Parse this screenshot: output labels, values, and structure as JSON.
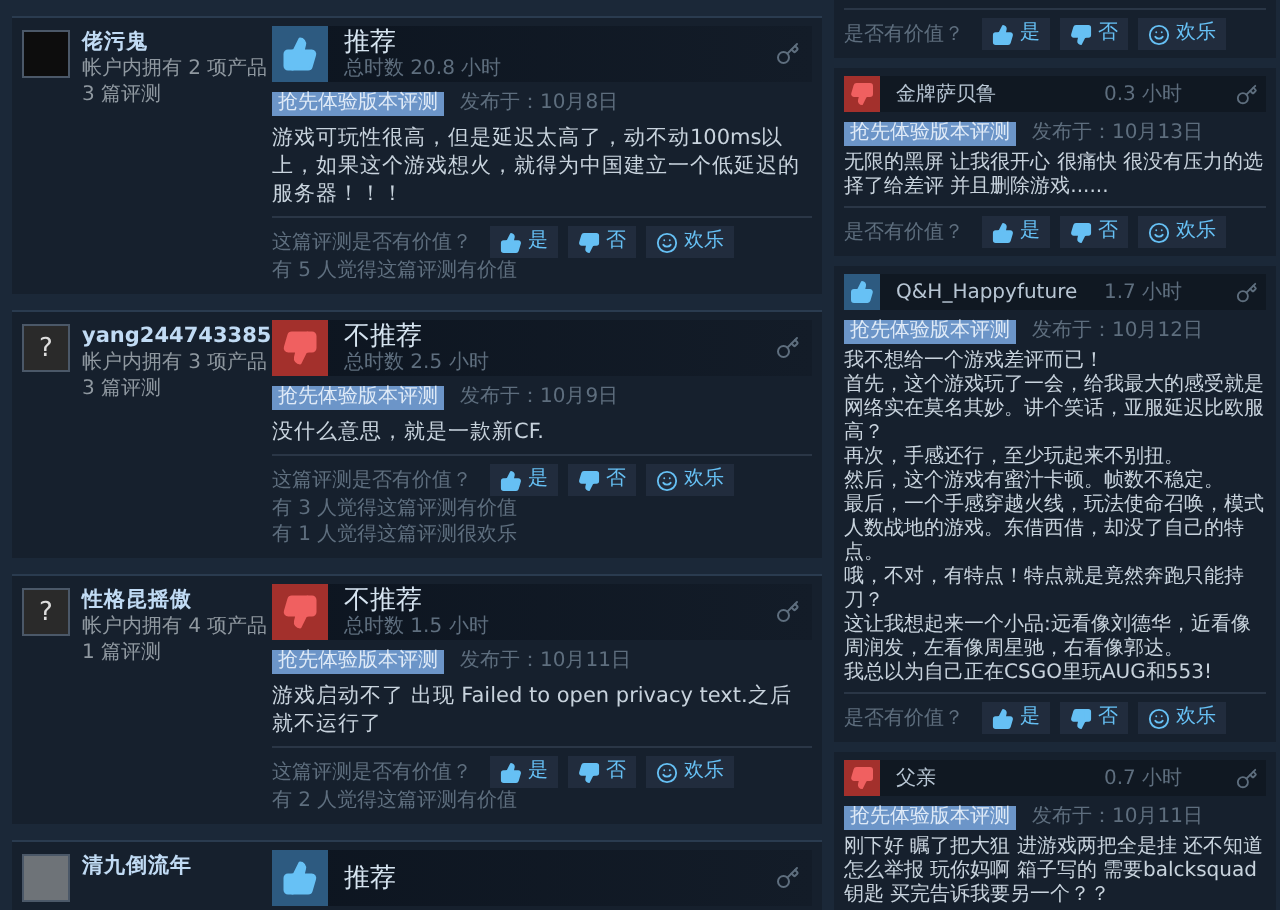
{
  "reviews": [
    {
      "author": {
        "name": "佬污鬼",
        "products": "帐户内拥有 2 项产品",
        "review_count": "3 篇评测",
        "avatar": {
          "kind": "image"
        }
      },
      "verdict": {
        "kind": "up",
        "label": "推荐"
      },
      "hours": "总时数 20.8 小时",
      "tag": "抢先体验版本评测",
      "posted": "发布于：10月8日",
      "body": "游戏可玩性很高，但是延迟太高了，动不动100ms以上，如果这个游戏想火，就得为中国建立一个低延迟的服务器！！！",
      "prompt": "这篇评测是否有价值？",
      "buttons": [
        {
          "kind": "up",
          "label": "是"
        },
        {
          "kind": "down",
          "label": "否"
        },
        {
          "kind": "funny",
          "label": "欢乐"
        }
      ],
      "counts": [
        "有 5 人觉得这篇评测有价值"
      ]
    },
    {
      "author": {
        "name": "yang244743385",
        "products": "帐户内拥有 3 项产品",
        "review_count": "3 篇评测",
        "avatar": {
          "kind": "unknown",
          "glyph": "?"
        }
      },
      "verdict": {
        "kind": "down",
        "label": "不推荐"
      },
      "hours": "总时数 2.5 小时",
      "tag": "抢先体验版本评测",
      "posted": "发布于：10月9日",
      "body": "没什么意思，就是一款新CF.",
      "prompt": "这篇评测是否有价值？",
      "buttons": [
        {
          "kind": "up",
          "label": "是"
        },
        {
          "kind": "down",
          "label": "否"
        },
        {
          "kind": "funny",
          "label": "欢乐"
        }
      ],
      "counts": [
        "有 3 人觉得这篇评测有价值",
        "有 1 人觉得这篇评测很欢乐"
      ]
    },
    {
      "author": {
        "name": "性格昆摇傲",
        "products": "帐户内拥有 4 项产品",
        "review_count": "1 篇评测",
        "avatar": {
          "kind": "unknown",
          "glyph": "?"
        }
      },
      "verdict": {
        "kind": "down",
        "label": "不推荐"
      },
      "hours": "总时数 1.5 小时",
      "tag": "抢先体验版本评测",
      "posted": "发布于：10月11日",
      "body": "游戏启动不了 出现 Failed to open privacy text.之后就不运行了",
      "prompt": "这篇评测是否有价值？",
      "buttons": [
        {
          "kind": "up",
          "label": "是"
        },
        {
          "kind": "down",
          "label": "否"
        },
        {
          "kind": "funny",
          "label": "欢乐"
        }
      ],
      "counts": [
        "有 2 人觉得这篇评测有价值"
      ]
    },
    {
      "author": {
        "name": "清九倒流年",
        "avatar": {
          "kind": "image"
        }
      },
      "verdict": {
        "kind": "up",
        "label": "推荐"
      }
    }
  ],
  "side_reviews": [
    {
      "prompt": "是否有价值？",
      "buttons": [
        {
          "kind": "up",
          "label": "是"
        },
        {
          "kind": "down",
          "label": "否"
        },
        {
          "kind": "funny",
          "label": "欢乐"
        }
      ]
    },
    {
      "verdict": {
        "kind": "down"
      },
      "name": "金牌萨贝鲁",
      "hours": "0.3 小时",
      "tag": "抢先体验版本评测",
      "posted": "发布于：10月13日",
      "body": "无限的黑屏 让我很开心 很痛快 很没有压力的选择了给差评 并且删除游戏......",
      "prompt": "是否有价值？",
      "buttons": [
        {
          "kind": "up",
          "label": "是"
        },
        {
          "kind": "down",
          "label": "否"
        },
        {
          "kind": "funny",
          "label": "欢乐"
        }
      ]
    },
    {
      "verdict": {
        "kind": "up"
      },
      "name": "Q&H_Happyfuture",
      "hours": "1.7 小时",
      "tag": "抢先体验版本评测",
      "posted": "发布于：10月12日",
      "paragraphs": [
        "我不想给一个游戏差评而已！",
        "首先，这个游戏玩了一会，给我最大的感受就是网络实在莫名其妙。讲个笑话，亚服延迟比欧服高？",
        "再次，手感还行，至少玩起来不别扭。",
        "然后，这个游戏有蜜汁卡顿。帧数不稳定。",
        "最后，一个手感穿越火线，玩法使命召唤，模式人数战地的游戏。东借西借，却没了自己的特点。",
        "哦，不对，有特点！特点就是竟然奔跑只能持刀？",
        "这让我想起来一个小品:远看像刘德华，近看像周润发，左看像周星驰，右看像郭达。",
        "我总以为自己正在CSGO里玩AUG和553!"
      ],
      "prompt": "是否有价值？",
      "buttons": [
        {
          "kind": "up",
          "label": "是"
        },
        {
          "kind": "down",
          "label": "否"
        },
        {
          "kind": "funny",
          "label": "欢乐"
        }
      ]
    },
    {
      "verdict": {
        "kind": "down"
      },
      "name": "父亲",
      "hours": "0.7 小时",
      "tag": "抢先体验版本评测",
      "posted": "发布于：10月11日",
      "body": "刚下好 瞩了把大狙 进游戏两把全是挂 还不知道怎么举报 玩你妈啊 箱子写的 需要balcksquad钥匙 买完告诉我要另一个？？"
    }
  ]
}
